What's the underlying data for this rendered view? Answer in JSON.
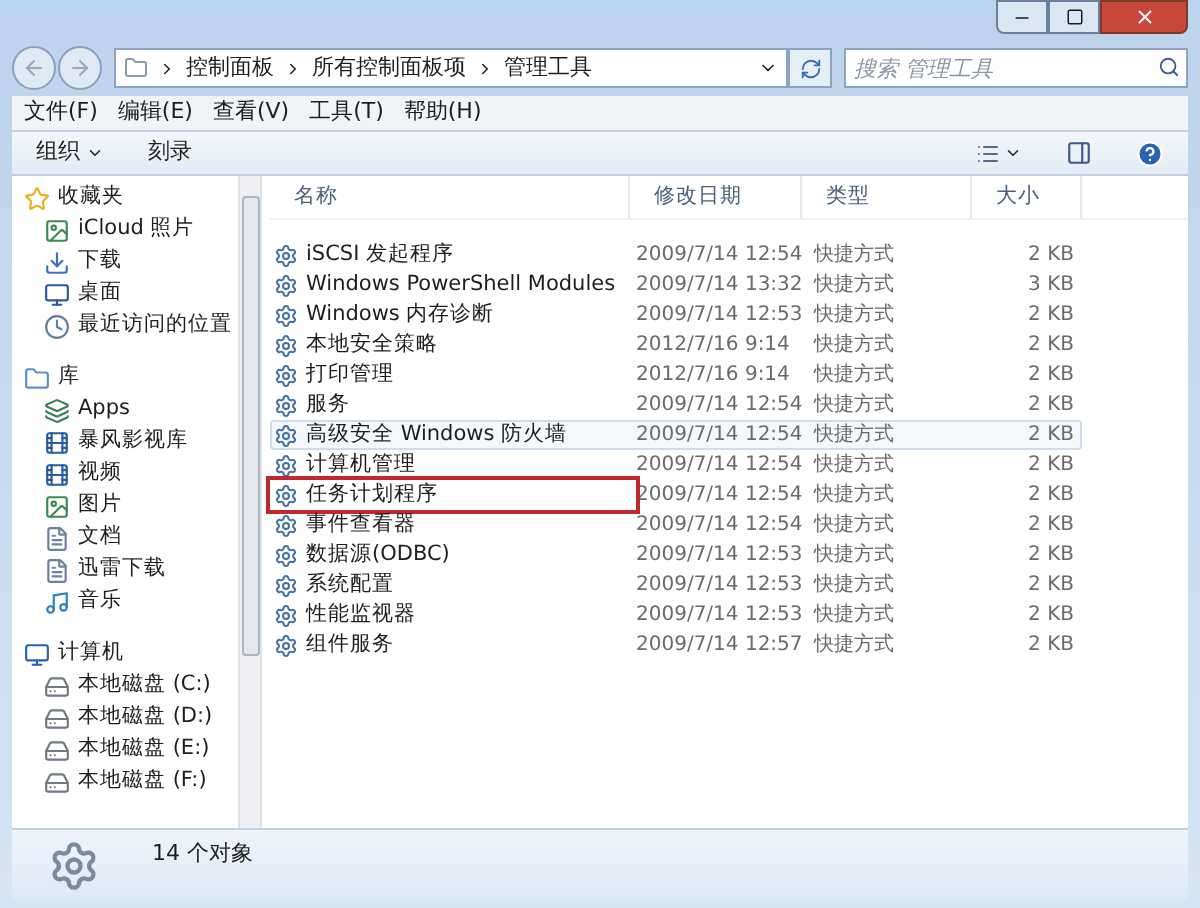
{
  "address": {
    "crumbs": [
      "控制面板",
      "所有控制面板项",
      "管理工具"
    ]
  },
  "search": {
    "placeholder": "搜索 管理工具"
  },
  "menu": [
    "文件(F)",
    "编辑(E)",
    "查看(V)",
    "工具(T)",
    "帮助(H)"
  ],
  "toolbar": [
    "组织",
    "刻录"
  ],
  "sidebar": [
    {
      "label": "收藏夹",
      "kind": "favorites",
      "children": [
        {
          "label": "iCloud 照片",
          "kind": "photos"
        },
        {
          "label": "下载",
          "kind": "download"
        },
        {
          "label": "桌面",
          "kind": "desktop"
        },
        {
          "label": "最近访问的位置",
          "kind": "recent"
        }
      ]
    },
    {
      "label": "库",
      "kind": "library",
      "children": [
        {
          "label": "Apps",
          "kind": "apps"
        },
        {
          "label": "暴风影视库",
          "kind": "video"
        },
        {
          "label": "视频",
          "kind": "video"
        },
        {
          "label": "图片",
          "kind": "photos"
        },
        {
          "label": "文档",
          "kind": "doc"
        },
        {
          "label": "迅雷下载",
          "kind": "doc"
        },
        {
          "label": "音乐",
          "kind": "music"
        }
      ]
    },
    {
      "label": "计算机",
      "kind": "computer",
      "children": [
        {
          "label": "本地磁盘 (C:)",
          "kind": "drive"
        },
        {
          "label": "本地磁盘 (D:)",
          "kind": "drive"
        },
        {
          "label": "本地磁盘 (E:)",
          "kind": "drive"
        },
        {
          "label": "本地磁盘 (F:)",
          "kind": "drive"
        }
      ]
    }
  ],
  "table": {
    "columns": [
      "名称",
      "修改日期",
      "类型",
      "大小"
    ],
    "rows": [
      {
        "cells": [
          "iSCSI 发起程序",
          "2009/7/14 12:54",
          "快捷方式",
          "2 KB"
        ],
        "hovered": false,
        "highlighted": false
      },
      {
        "cells": [
          "Windows PowerShell Modules",
          "2009/7/14 13:32",
          "快捷方式",
          "3 KB"
        ],
        "hovered": false,
        "highlighted": false
      },
      {
        "cells": [
          "Windows 内存诊断",
          "2009/7/14 12:53",
          "快捷方式",
          "2 KB"
        ],
        "hovered": false,
        "highlighted": false
      },
      {
        "cells": [
          "本地安全策略",
          "2012/7/16 9:14",
          "快捷方式",
          "2 KB"
        ],
        "hovered": false,
        "highlighted": false
      },
      {
        "cells": [
          "打印管理",
          "2012/7/16 9:14",
          "快捷方式",
          "2 KB"
        ],
        "hovered": false,
        "highlighted": false
      },
      {
        "cells": [
          "服务",
          "2009/7/14 12:54",
          "快捷方式",
          "2 KB"
        ],
        "hovered": false,
        "highlighted": false
      },
      {
        "cells": [
          "高级安全 Windows 防火墙",
          "2009/7/14 12:54",
          "快捷方式",
          "2 KB"
        ],
        "hovered": true,
        "highlighted": false
      },
      {
        "cells": [
          "计算机管理",
          "2009/7/14 12:54",
          "快捷方式",
          "2 KB"
        ],
        "hovered": false,
        "highlighted": false
      },
      {
        "cells": [
          "任务计划程序",
          "2009/7/14 12:54",
          "快捷方式",
          "2 KB"
        ],
        "hovered": false,
        "highlighted": true
      },
      {
        "cells": [
          "事件查看器",
          "2009/7/14 12:54",
          "快捷方式",
          "2 KB"
        ],
        "hovered": false,
        "highlighted": false
      },
      {
        "cells": [
          "数据源(ODBC)",
          "2009/7/14 12:53",
          "快捷方式",
          "2 KB"
        ],
        "hovered": false,
        "highlighted": false
      },
      {
        "cells": [
          "系统配置",
          "2009/7/14 12:53",
          "快捷方式",
          "2 KB"
        ],
        "hovered": false,
        "highlighted": false
      },
      {
        "cells": [
          "性能监视器",
          "2009/7/14 12:53",
          "快捷方式",
          "2 KB"
        ],
        "hovered": false,
        "highlighted": false
      },
      {
        "cells": [
          "组件服务",
          "2009/7/14 12:57",
          "快捷方式",
          "2 KB"
        ],
        "hovered": false,
        "highlighted": false
      }
    ]
  },
  "status_bar": {
    "count": "14 个对象"
  }
}
